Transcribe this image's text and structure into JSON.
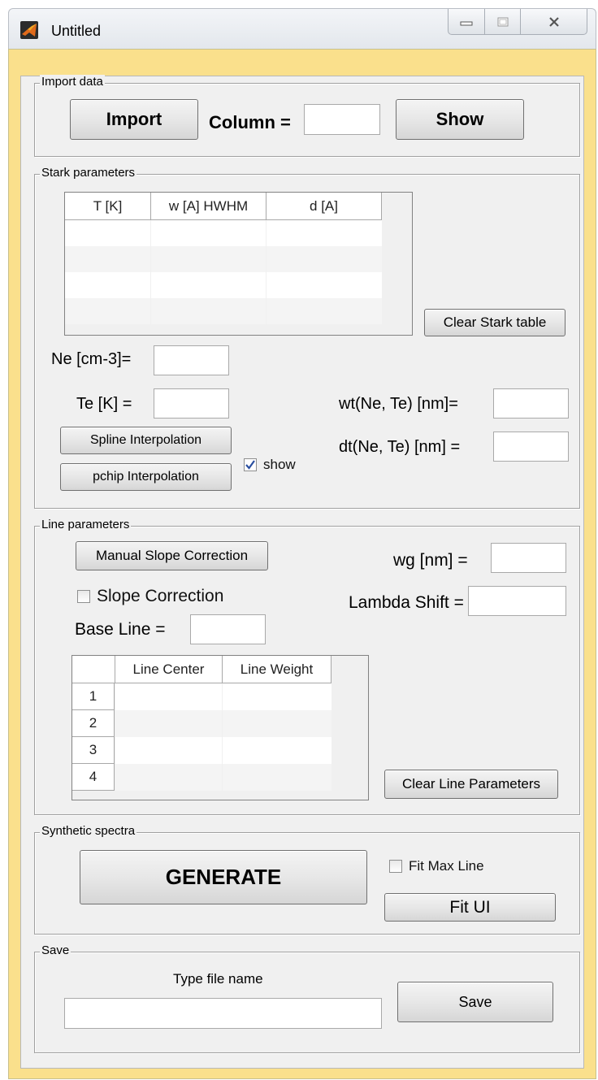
{
  "window": {
    "title": "Untitled",
    "accent_color": "#fae08c",
    "icons": {
      "app": "matlab-icon",
      "minimize": "minimize-icon",
      "maximize": "maximize-icon",
      "close": "close-icon"
    }
  },
  "import_panel": {
    "title": "Import data",
    "import_label": "Import",
    "column_label": "Column =",
    "column_value": "",
    "show_label": "Show"
  },
  "stark_panel": {
    "title": "Stark parameters",
    "table": {
      "columns": [
        "T [K]",
        "w [A] HWHM",
        "d [A]"
      ],
      "rows": [
        [
          "",
          "",
          ""
        ],
        [
          "",
          "",
          ""
        ],
        [
          "",
          "",
          ""
        ],
        [
          "",
          "",
          ""
        ]
      ]
    },
    "clear_label": "Clear Stark table",
    "ne_label": "Ne [cm-3]=",
    "ne_value": "",
    "te_label": "Te [K] =",
    "te_value": "",
    "spline_label": "Spline Interpolation",
    "pchip_label": "pchip Interpolation",
    "show_label": "show",
    "show_checked": true,
    "wt_label": "wt(Ne, Te) [nm]=",
    "wt_value": "",
    "dt_label": "dt(Ne, Te) [nm] =",
    "dt_value": ""
  },
  "line_panel": {
    "title": "Line parameters",
    "manual_slope_label": "Manual Slope Correction",
    "slope_label": "Slope Correction",
    "slope_checked": false,
    "base_line_label": "Base Line =",
    "base_line_value": "",
    "wg_label": "wg [nm] =",
    "wg_value": "",
    "lambda_label": "Lambda Shift =",
    "lambda_value": "",
    "table": {
      "columns": [
        "Line Center",
        "Line Weight"
      ],
      "row_headers": [
        "1",
        "2",
        "3",
        "4"
      ],
      "rows": [
        [
          "",
          ""
        ],
        [
          "",
          ""
        ],
        [
          "",
          ""
        ],
        [
          "",
          ""
        ]
      ]
    },
    "clear_label": "Clear Line Parameters"
  },
  "synthetic_panel": {
    "title": "Synthetic spectra",
    "generate_label": "GENERATE",
    "fit_max_label": "Fit Max Line",
    "fit_max_checked": false,
    "fit_ui_label": "Fit UI"
  },
  "save_panel": {
    "title": "Save",
    "type_label": "Type file name",
    "file_name_value": "",
    "save_label": "Save"
  }
}
